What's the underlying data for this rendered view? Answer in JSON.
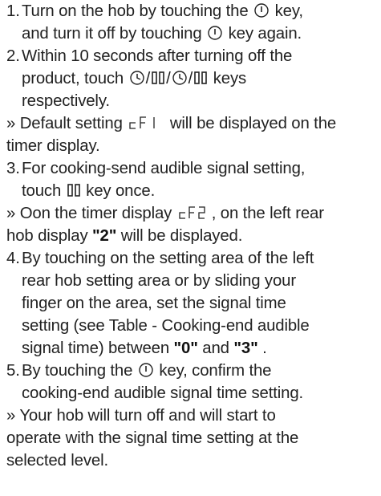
{
  "icons": {
    "power": "power-key-icon",
    "timer": "timer-key-icon",
    "pause": "pause-key-icon",
    "display_cf1": "cF1-display-icon",
    "display_cf2": "cF2-display-icon"
  },
  "steps": [
    {
      "num": "1.",
      "p1": "Turn on the hob by touching the",
      "p2": "key,",
      "p3": "and turn it off by touching",
      "p4": "key again."
    },
    {
      "num": "2.",
      "p1": "Within 10 seconds after turning off the",
      "p2": "product, touch",
      "sep": "/",
      "p3": "keys",
      "p4": "respectively."
    },
    {
      "num": "3.",
      "p1": "For cooking-send audible signal setting,",
      "p2": "touch",
      "p3": "key once."
    },
    {
      "num": "4.",
      "p1": "By touching on the setting area of the left",
      "p2": "rear hob setting area or by sliding your",
      "p3": "finger on the area, set the signal time",
      "p4": "setting (see Table - Cooking-end audible",
      "p5": "signal time) between",
      "b1": "\"0\"",
      "and": "and",
      "b2": "\"3\"",
      "p6": "."
    },
    {
      "num": "5.",
      "p1": "By touching the",
      "p2": "key, confirm the",
      "p3": "cooking-end audible signal time setting."
    }
  ],
  "notes": [
    {
      "p1": "» Default setting",
      "p2": "will be displayed on the",
      "p3": "timer display."
    },
    {
      "p1": "» Oon the timer display",
      "p2": ", on the left rear",
      "p3": "hob display",
      "b1": "\"2\"",
      "p4": "will be displayed."
    },
    {
      "p1": "» Your hob will turn off and will start to",
      "p2": "operate with the signal time setting at the",
      "p3": "selected level."
    }
  ]
}
